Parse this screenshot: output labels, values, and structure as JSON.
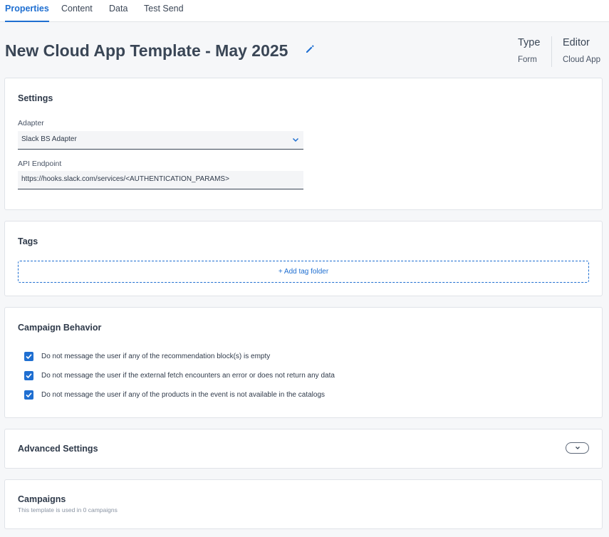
{
  "tabs": [
    {
      "label": "Properties",
      "active": true
    },
    {
      "label": "Content",
      "active": false
    },
    {
      "label": "Data",
      "active": false
    },
    {
      "label": "Test Send",
      "active": false
    }
  ],
  "header": {
    "title": "New Cloud App Template - May 2025",
    "edit_icon": "pencil-icon",
    "type_label": "Type",
    "type_value": "Form",
    "editor_label": "Editor",
    "editor_value": "Cloud App"
  },
  "settings": {
    "title": "Settings",
    "adapter_label": "Adapter",
    "adapter_value": "Slack BS Adapter",
    "endpoint_label": "API Endpoint",
    "endpoint_value": "https://hooks.slack.com/services/<AUTHENTICATION_PARAMS>"
  },
  "tags": {
    "title": "Tags",
    "add_label": "+ Add tag folder"
  },
  "campaign_behavior": {
    "title": "Campaign Behavior",
    "options": [
      {
        "label": "Do not message the user if any of the recommendation block(s) is empty",
        "checked": true
      },
      {
        "label": "Do not message the user if the external fetch encounters an error or does not return any data",
        "checked": true
      },
      {
        "label": "Do not message the user if any of the products in the event is not available in the catalogs",
        "checked": true
      }
    ]
  },
  "advanced": {
    "title": "Advanced Settings"
  },
  "campaigns": {
    "title": "Campaigns",
    "subtitle": "This template is used in 0 campaigns"
  },
  "colors": {
    "accent": "#1f6fd1",
    "text": "#2f3a4a",
    "background": "#f6f7f9"
  }
}
